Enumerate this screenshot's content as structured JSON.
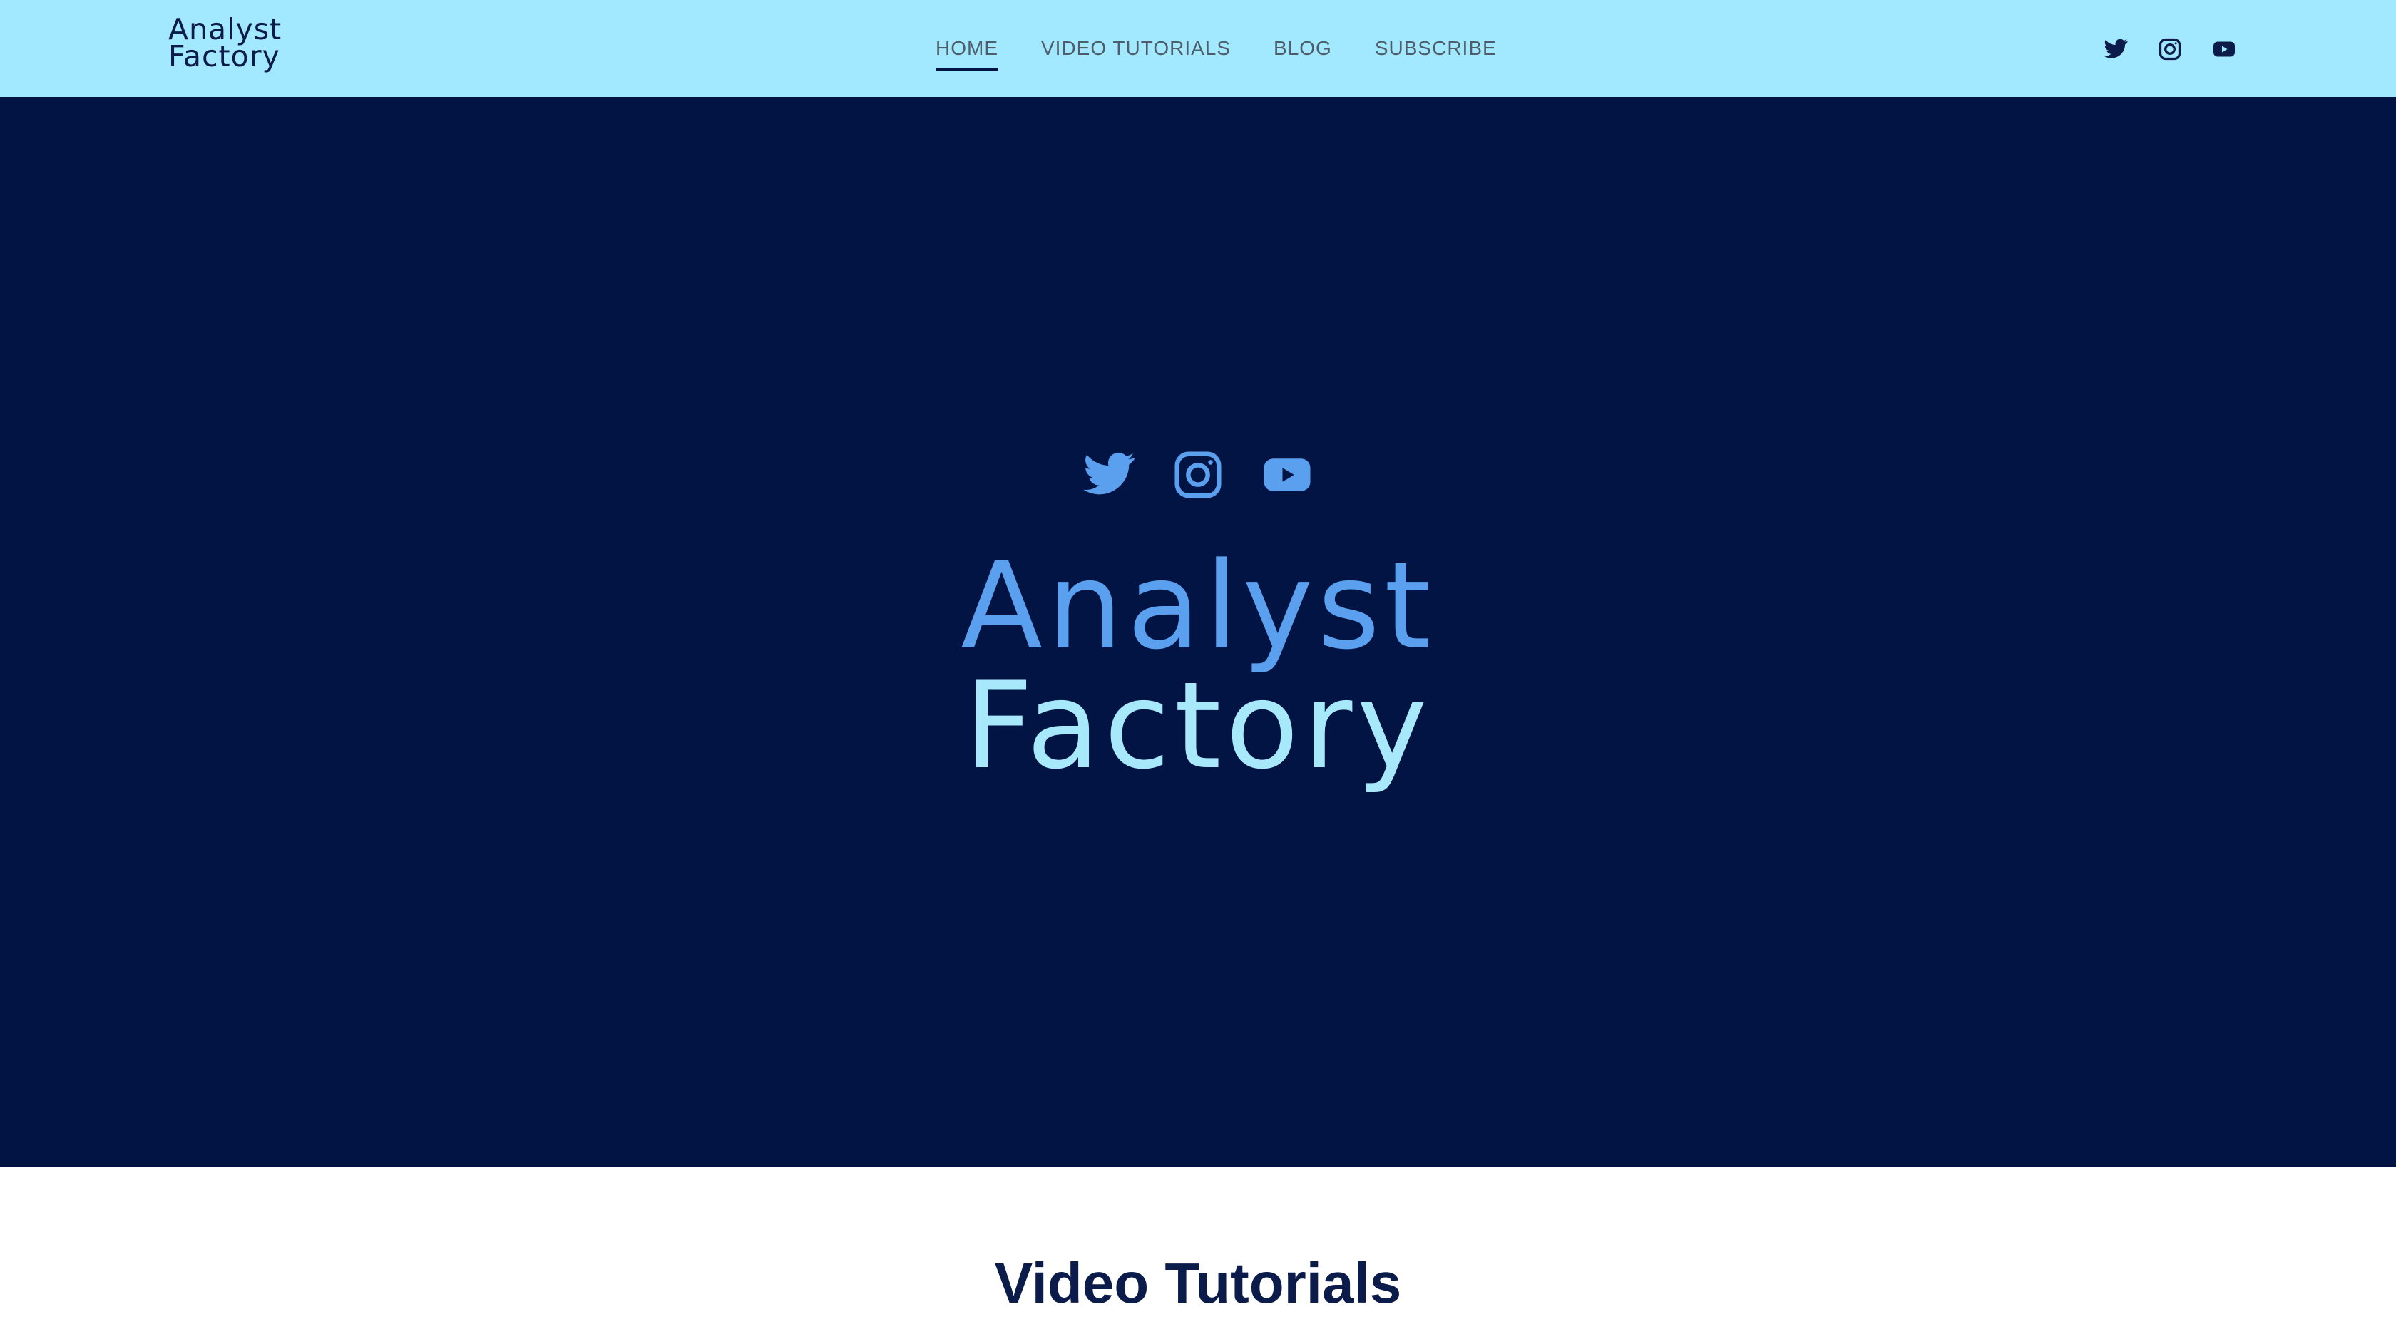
{
  "header": {
    "brand_line1": "Analyst",
    "brand_line2": "Factory",
    "nav": [
      {
        "label": "HOME",
        "active": true
      },
      {
        "label": "VIDEO TUTORIALS",
        "active": false
      },
      {
        "label": "BLOG",
        "active": false
      },
      {
        "label": "SUBSCRIBE",
        "active": false
      }
    ],
    "social_icons": [
      "twitter-icon",
      "instagram-icon",
      "youtube-icon"
    ]
  },
  "hero": {
    "social_icons": [
      "twitter-icon",
      "instagram-icon",
      "youtube-icon"
    ],
    "title_line1": "Analyst",
    "title_line2": "Factory"
  },
  "section": {
    "title": "Video Tutorials"
  },
  "colors": {
    "header_bg": "#a2e8fe",
    "hero_bg": "#021444",
    "accent_blue": "#5aa0ee",
    "accent_light": "#a7e9fb",
    "text_dark": "#0b1b4a"
  }
}
